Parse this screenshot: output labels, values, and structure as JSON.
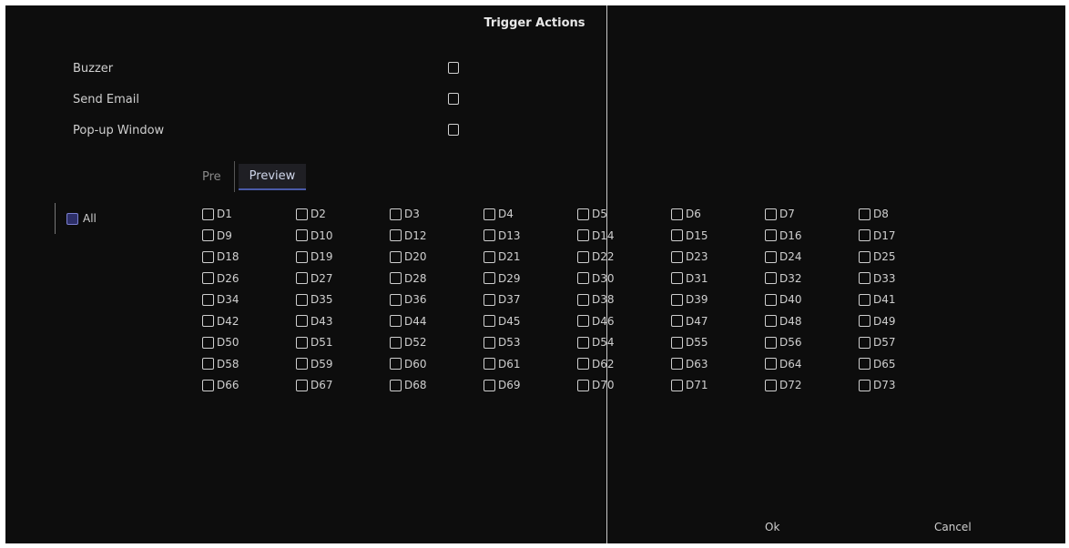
{
  "dialog": {
    "title": "Trigger Actions"
  },
  "options": [
    {
      "label": "Buzzer",
      "checked": false
    },
    {
      "label": "Send Email",
      "checked": false
    },
    {
      "label": "Pop-up Window",
      "checked": false
    }
  ],
  "tabs": [
    {
      "label": "Pre",
      "active": false
    },
    {
      "label": "Preview",
      "active": true
    }
  ],
  "select_all": {
    "label": "All",
    "checked": false
  },
  "cameras": [
    "D1",
    "D2",
    "D3",
    "D4",
    "D5",
    "D6",
    "D7",
    "D8",
    "D9",
    "D10",
    "D12",
    "D13",
    "D14",
    "D15",
    "D16",
    "D17",
    "D18",
    "D19",
    "D20",
    "D21",
    "D22",
    "D23",
    "D24",
    "D25",
    "D26",
    "D27",
    "D28",
    "D29",
    "D30",
    "D31",
    "D32",
    "D33",
    "D34",
    "D35",
    "D36",
    "D37",
    "D38",
    "D39",
    "D40",
    "D41",
    "D42",
    "D43",
    "D44",
    "D45",
    "D46",
    "D47",
    "D48",
    "D49",
    "D50",
    "D51",
    "D52",
    "D53",
    "D54",
    "D55",
    "D56",
    "D57",
    "D58",
    "D59",
    "D60",
    "D61",
    "D62",
    "D63",
    "D64",
    "D65",
    "D66",
    "D67",
    "D68",
    "D69",
    "D70",
    "D71",
    "D72",
    "D73"
  ],
  "footer": {
    "ok_label": "Ok",
    "cancel_label": "Cancel"
  },
  "colors": {
    "background": "#0d0d0d",
    "accent": "#4a5aa8"
  }
}
